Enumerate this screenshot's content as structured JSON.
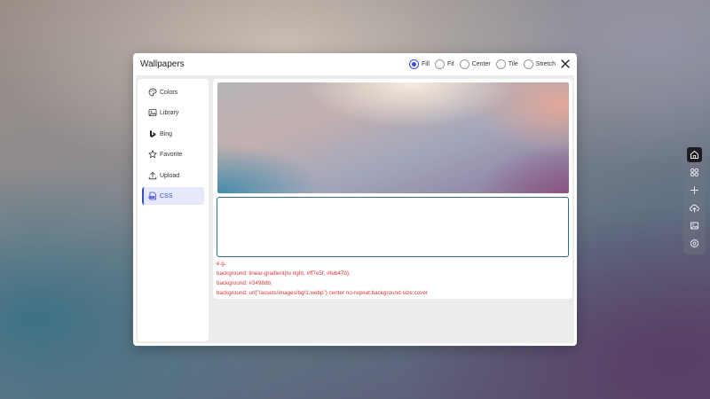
{
  "dialog": {
    "title": "Wallpapers",
    "fit_options": [
      {
        "label": "Fill",
        "checked": true
      },
      {
        "label": "Fit",
        "checked": false
      },
      {
        "label": "Center",
        "checked": false
      },
      {
        "label": "Tile",
        "checked": false
      },
      {
        "label": "Stretch",
        "checked": false
      }
    ]
  },
  "sidebar": {
    "items": [
      {
        "label": "Colors",
        "icon": "palette-icon",
        "active": false
      },
      {
        "label": "Library",
        "icon": "image-icon",
        "active": false
      },
      {
        "label": "Bing",
        "icon": "bing-icon",
        "active": false
      },
      {
        "label": "Favorite",
        "icon": "star-icon",
        "active": false
      },
      {
        "label": "Upload",
        "icon": "upload-icon",
        "active": false
      },
      {
        "label": "CSS",
        "icon": "css-file-icon",
        "active": true
      }
    ]
  },
  "css_panel": {
    "input_value": "",
    "hint_lines": [
      "e.g.",
      "background: linear-gradient(to right, #ff7e5f, #feb47b);",
      "background: #3498db;",
      "background: url(\"/assets/images/bg/1.webp\") center no-repeat;background-size:cover"
    ]
  },
  "toolbar": {
    "items": [
      {
        "icon": "home-icon",
        "active": true
      },
      {
        "icon": "apps-icon",
        "active": false
      },
      {
        "icon": "plus-icon",
        "active": false
      },
      {
        "icon": "cloud-upload-icon",
        "active": false
      },
      {
        "icon": "wallpaper-icon",
        "active": false
      },
      {
        "icon": "gear-icon",
        "active": false
      }
    ]
  },
  "colors": {
    "accent": "#3b4bd8",
    "hint_red": "#d9363e",
    "input_border": "#2f6f86"
  }
}
